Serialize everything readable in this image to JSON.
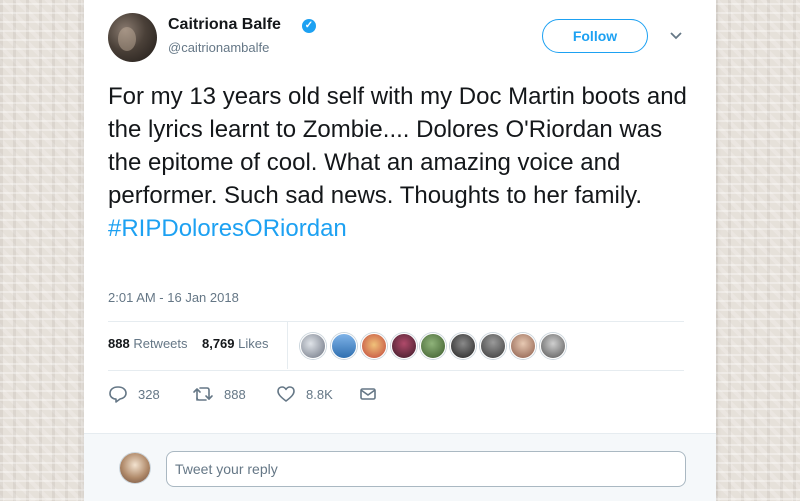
{
  "tweet": {
    "user": {
      "name": "Caitriona Balfe",
      "handle": "@caitrionambalfe",
      "verified_icon": "verified-check-icon"
    },
    "follow_label": "Follow",
    "text": "For my 13 years old self with my Doc Martin boots and the lyrics learnt to Zombie.... Dolores O'Riordan was the epitome of cool. What an amazing voice and performer. Such sad news. Thoughts to her family.",
    "hashtag": "#RIPDoloresORiordan",
    "timestamp": "2:01 AM - 16 Jan 2018",
    "stats": {
      "retweets_count": "888",
      "retweets_label": "Retweets",
      "likes_count": "8,769",
      "likes_label": "Likes"
    },
    "actions": {
      "replies": "328",
      "retweets": "888",
      "likes": "8.8K"
    }
  },
  "reply": {
    "placeholder": "Tweet your reply"
  },
  "colors": {
    "accent": "#1da1f2",
    "text": "#14171a",
    "muted": "#657786",
    "border": "#e6ecf0"
  },
  "liker_avatar_count": 9
}
